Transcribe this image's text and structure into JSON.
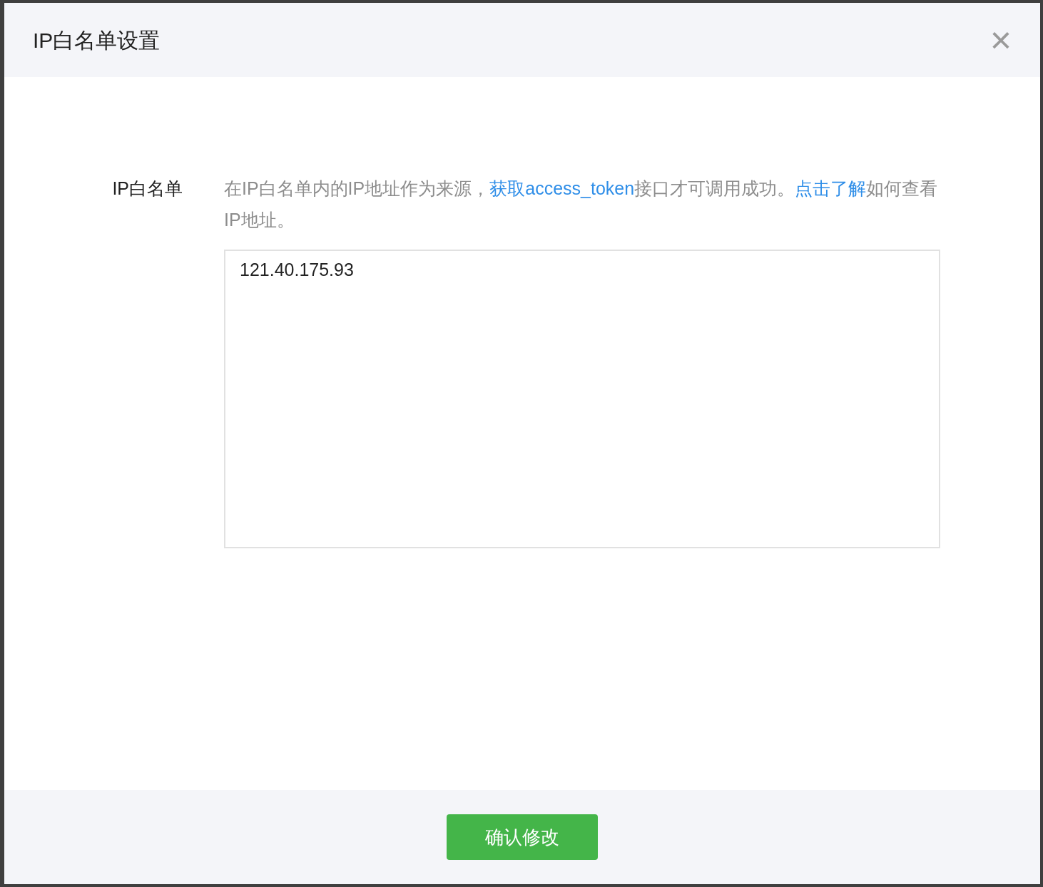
{
  "dialog": {
    "title": "IP白名单设置",
    "close_label": "×"
  },
  "form": {
    "label": "IP白名单",
    "description": [
      {
        "kind": "text",
        "text": "在IP白名单内的IP地址作为来源，"
      },
      {
        "kind": "link",
        "text": "获取access_token"
      },
      {
        "kind": "text",
        "text": "接口才可调用成功。"
      },
      {
        "kind": "link",
        "text": "点击了解"
      },
      {
        "kind": "text",
        "text": "如何查看IP地址。"
      }
    ],
    "ip_list": {
      "value": "121.40.175.93"
    }
  },
  "footer": {
    "confirm_button": "确认修改"
  }
}
